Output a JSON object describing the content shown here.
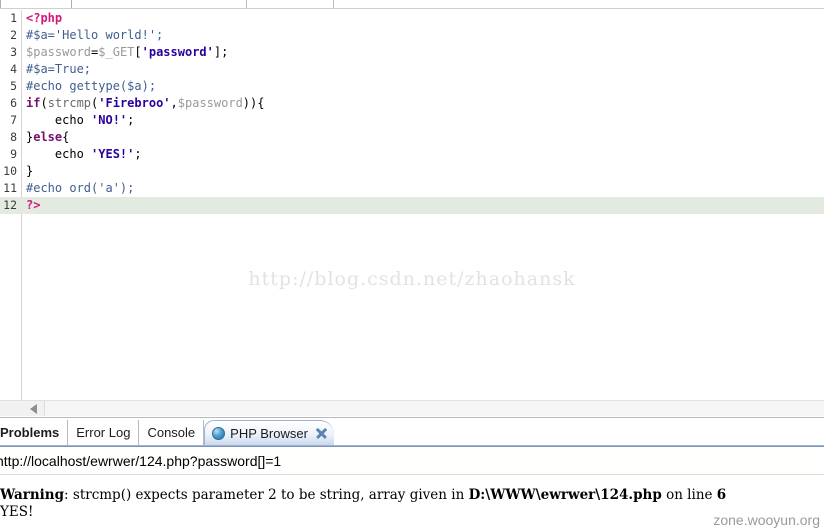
{
  "editor": {
    "watermark": "http://blog.csdn.net/zhaohansk",
    "language": "php",
    "current_line": 12,
    "current_line_highlight_color": "#e3eadf",
    "lines": [
      {
        "num": "1",
        "text": "<?php"
      },
      {
        "num": "2",
        "text": "#$a='Hello world!';"
      },
      {
        "num": "3",
        "text": "$password=$_GET['password'];"
      },
      {
        "num": "4",
        "text": "#$a=True;"
      },
      {
        "num": "5",
        "text": "#echo gettype($a);"
      },
      {
        "num": "6",
        "text": "if(strcmp('Firebroo',$password)){"
      },
      {
        "num": "7",
        "text": "    echo 'NO!';"
      },
      {
        "num": "8",
        "text": "}else{"
      },
      {
        "num": "9",
        "text": "    echo 'YES!';"
      },
      {
        "num": "10",
        "text": "}"
      },
      {
        "num": "11",
        "text": "#echo ord('a');"
      },
      {
        "num": "12",
        "text": "?>"
      }
    ]
  },
  "scrollbar": {
    "left_arrow_icon": "triangle-left-icon"
  },
  "view_tabs": [
    {
      "label": "Problems",
      "active": false,
      "truncated": true,
      "icon": null,
      "closable": false
    },
    {
      "label": "Error Log",
      "active": false,
      "truncated": false,
      "icon": null,
      "closable": false
    },
    {
      "label": "Console",
      "active": false,
      "truncated": false,
      "icon": null,
      "closable": false
    },
    {
      "label": "PHP Browser",
      "active": true,
      "truncated": false,
      "icon": "globe-icon",
      "closable": true
    }
  ],
  "php_browser": {
    "url": "http://localhost/ewrwer/124.php?password[]=1",
    "url_placeholder": "http://",
    "output": {
      "warning_label": "Warning",
      "warning_rest_1": ": strcmp() expects parameter 2 to be string, array given in ",
      "warning_file": "D:\\WWW\\ewrwer\\124.php",
      "warning_rest_2": " on line ",
      "warning_line": "6",
      "result": "YES!"
    }
  },
  "watermarks": {
    "page": "zone.wooyun.org"
  },
  "colors": {
    "tag": "#d1197d",
    "comment": "#3f5f8f",
    "variable": "#9a9a9a",
    "keyword": "#7a0f6e",
    "string": "#2a00a0",
    "current_line": "#e3eadf",
    "tab_active": "#c9d9ee"
  }
}
